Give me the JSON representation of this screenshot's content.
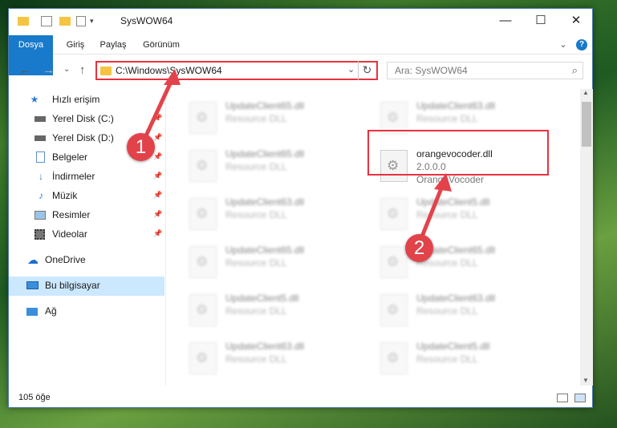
{
  "window": {
    "title": "SysWOW64",
    "minimize": "—",
    "maximize": "☐",
    "close": "✕"
  },
  "ribbon": {
    "tabs": [
      "Dosya",
      "Giriş",
      "Paylaş",
      "Görünüm"
    ],
    "chevron": "⌄",
    "help": "?"
  },
  "address": {
    "path": "C:\\Windows\\SysWOW64",
    "back": "←",
    "forward": "→",
    "recent": "⌄",
    "up": "↑",
    "dropdown": "⌄",
    "refresh": "↻"
  },
  "search": {
    "placeholder": "Ara: SysWOW64",
    "icon": "search-icon"
  },
  "sidebar": {
    "items": [
      {
        "label": "Hızlı erişim",
        "icon": "star-icon",
        "pinned": false
      },
      {
        "label": "Yerel Disk (C:)",
        "icon": "drive-icon",
        "pinned": true
      },
      {
        "label": "Yerel Disk (D:)",
        "icon": "drive-icon",
        "pinned": true
      },
      {
        "label": "Belgeler",
        "icon": "documents-icon",
        "pinned": true
      },
      {
        "label": "İndirmeler",
        "icon": "download-icon",
        "pinned": true
      },
      {
        "label": "Müzik",
        "icon": "music-icon",
        "pinned": true
      },
      {
        "label": "Resimler",
        "icon": "pictures-icon",
        "pinned": true
      },
      {
        "label": "Videolar",
        "icon": "video-icon",
        "pinned": true
      },
      {
        "label": "OneDrive",
        "icon": "cloud-icon",
        "pinned": false
      },
      {
        "label": "Bu bilgisayar",
        "icon": "computer-icon",
        "pinned": false
      },
      {
        "label": "Ağ",
        "icon": "network-icon",
        "pinned": false
      }
    ]
  },
  "files": {
    "highlighted": {
      "name": "orangevocoder.dll",
      "version": "2.0.0.0",
      "company": "OrangeVocoder"
    },
    "left_column": [
      {
        "name": "UpdateClient65.dll",
        "type": "Resource DLL"
      },
      {
        "name": "UpdateClient65.dll",
        "type": "Resource DLL"
      },
      {
        "name": "UpdateClient63.dll",
        "type": "Resource DLL"
      },
      {
        "name": "UpdateClient65.dll",
        "type": "Resource DLL"
      },
      {
        "name": "UpdateClient5.dll",
        "type": "Resource DLL"
      },
      {
        "name": "UpdateClient63.dll",
        "type": "Resource DLL"
      }
    ],
    "right_column": [
      {
        "name": "UpdateClient63.dll",
        "type": "Resource DLL"
      },
      {
        "name": "UpdateClient5.dll",
        "type": "Resource DLL"
      },
      {
        "name": "UpdateClient65.dll",
        "type": "Resource DLL"
      },
      {
        "name": "UpdateClient63.dll",
        "type": "Resource DLL"
      },
      {
        "name": "UpdateClient5.dll",
        "type": "Resource DLL"
      }
    ]
  },
  "status": {
    "count": "105 öğe"
  },
  "annotations": {
    "step1": "1",
    "step2": "2",
    "color": "#e2434a"
  }
}
